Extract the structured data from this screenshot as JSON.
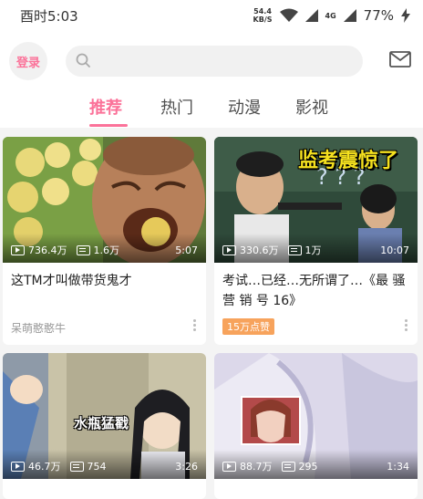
{
  "status": {
    "time": "酉时5:03",
    "speed_value": "54.4",
    "speed_unit": "KB/S",
    "network": "4G",
    "battery": "77%"
  },
  "header": {
    "login_label": "登录",
    "search_placeholder": "",
    "accent_color": "#fb7299"
  },
  "tabs": [
    {
      "label": "推荐",
      "active": true
    },
    {
      "label": "热门",
      "active": false
    },
    {
      "label": "动漫",
      "active": false
    },
    {
      "label": "影视",
      "active": false
    }
  ],
  "feed": [
    {
      "title": "这TM才叫做带货鬼才",
      "views": "736.4万",
      "danmaku": "1.6万",
      "duration": "5:07",
      "up": "呆萌憨憨牛",
      "badge": ""
    },
    {
      "title": "考试…已经…无所谓了…《最 骚 营 销 号 16》",
      "views": "330.6万",
      "danmaku": "1万",
      "duration": "10:07",
      "up": "",
      "badge": "15万点赞",
      "thumb_caption": "监考震惊了"
    },
    {
      "title": "",
      "views": "46.7万",
      "danmaku": "754",
      "duration": "3:26",
      "up": "",
      "badge": "",
      "thumb_caption": "水瓶猛戳"
    },
    {
      "title": "",
      "views": "88.7万",
      "danmaku": "295",
      "duration": "1:34",
      "up": "",
      "badge": ""
    }
  ],
  "icons": [
    "search-icon",
    "mail-icon",
    "wifi-icon",
    "signal-icon",
    "battery-charging-icon",
    "play-count-icon",
    "danmaku-icon",
    "more-icon"
  ]
}
